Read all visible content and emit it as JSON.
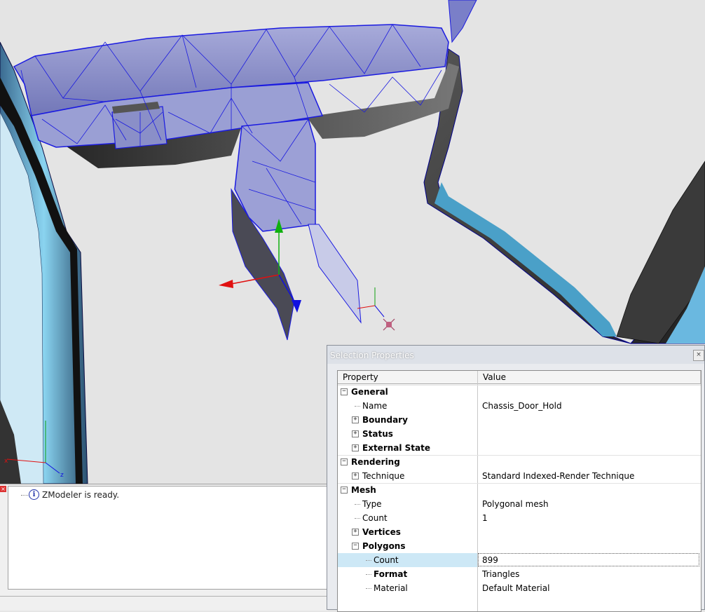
{
  "log": {
    "message": "ZModeler is ready."
  },
  "props": {
    "title": "Selection Properties",
    "columns": {
      "property": "Property",
      "value": "Value"
    },
    "rows": [
      {
        "label": "General",
        "value": "",
        "bold": true,
        "level": 0,
        "expander": "−"
      },
      {
        "label": "Name",
        "value": "Chassis_Door_Hold",
        "bold": false,
        "level": 1,
        "expander": ""
      },
      {
        "label": "Boundary",
        "value": "",
        "bold": true,
        "level": 1,
        "expander": "+"
      },
      {
        "label": "Status",
        "value": "",
        "bold": true,
        "level": 1,
        "expander": "+"
      },
      {
        "label": "External State",
        "value": "",
        "bold": true,
        "level": 1,
        "expander": "+"
      },
      {
        "label": "Rendering",
        "value": "",
        "bold": true,
        "level": 0,
        "expander": "−"
      },
      {
        "label": "Technique",
        "value": "Standard Indexed-Render Technique",
        "bold": false,
        "level": 1,
        "expander": "+"
      },
      {
        "label": "Mesh",
        "value": "",
        "bold": true,
        "level": 0,
        "expander": "−"
      },
      {
        "label": "Type",
        "value": "Polygonal mesh",
        "bold": false,
        "level": 1,
        "expander": ""
      },
      {
        "label": "Count",
        "value": "1",
        "bold": false,
        "level": 1,
        "expander": ""
      },
      {
        "label": "Vertices",
        "value": "",
        "bold": true,
        "level": 1,
        "expander": "+"
      },
      {
        "label": "Polygons",
        "value": "",
        "bold": true,
        "level": 1,
        "expander": "−"
      },
      {
        "label": "Count",
        "value": "899",
        "bold": false,
        "level": 2,
        "expander": "",
        "selected": true
      },
      {
        "label": "Format",
        "value": "Triangles",
        "bold": true,
        "level": 2,
        "expander": ""
      },
      {
        "label": "Material",
        "value": "Default Material",
        "bold": false,
        "level": 2,
        "expander": ""
      }
    ]
  },
  "colors": {
    "mesh_fill": "#9ea3d8",
    "wire": "#1a1ae0",
    "axis_x": "#e01010",
    "axis_y": "#10b010",
    "axis_z": "#1010e0",
    "selection_highlight": "#cde8f6"
  }
}
